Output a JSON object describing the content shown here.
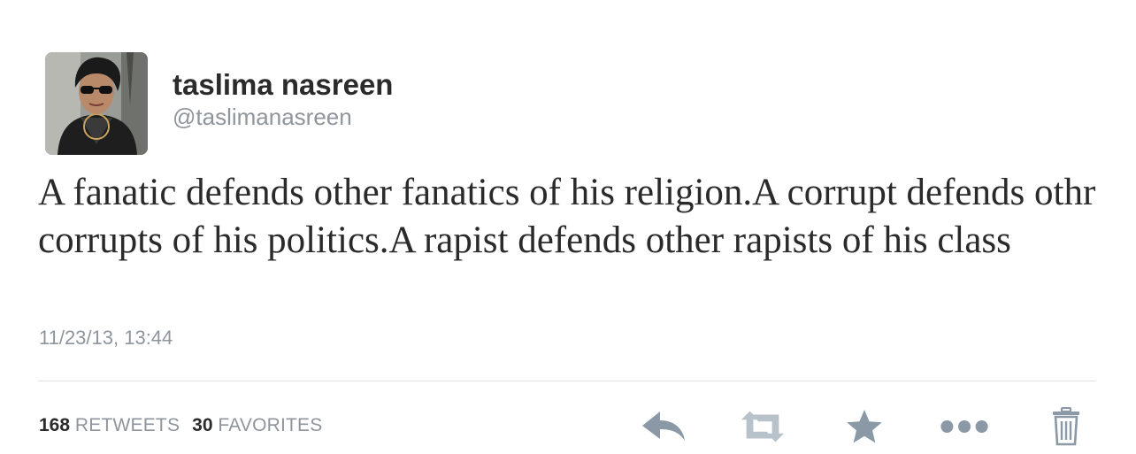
{
  "author": {
    "display_name": "taslima nasreen",
    "handle": "@taslimanasreen",
    "avatar_icon": "profile-photo"
  },
  "tweet": {
    "text": "A fanatic defends other fanatics of his religion.A corrupt defends othr corrupts of his politics.A rapist defends other rapists of his class",
    "timestamp": "11/23/13, 13:44"
  },
  "stats": {
    "retweets_count": "168",
    "retweets_label": "RETWEETS",
    "favorites_count": "30",
    "favorites_label": "FAVORITES"
  },
  "actions": [
    {
      "icon": "reply-icon"
    },
    {
      "icon": "retweet-icon"
    },
    {
      "icon": "favorite-star-icon"
    },
    {
      "icon": "more-dots-icon"
    },
    {
      "icon": "trash-icon"
    }
  ],
  "colors": {
    "icon_gray": "#8b98a5",
    "muted_text": "#8e959c",
    "primary_text": "#2b2b2b"
  }
}
